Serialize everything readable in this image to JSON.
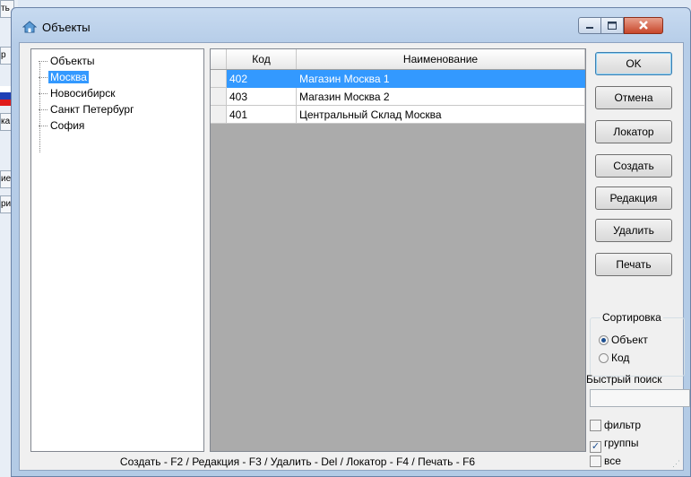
{
  "background": {
    "fragments": [
      "ть",
      "р",
      "ка",
      "ие",
      "ри"
    ]
  },
  "window": {
    "title": "Объекты",
    "icon": "home-icon"
  },
  "tree": {
    "root": "Объекты",
    "items": [
      "Москва",
      "Новосибирск",
      "Санкт Петербург",
      "София"
    ],
    "selected": "Москва"
  },
  "grid": {
    "columns": [
      "Код",
      "Наименование"
    ],
    "rows": [
      {
        "code": "402",
        "name": "Магазин Москва 1",
        "selected": true
      },
      {
        "code": "403",
        "name": "Магазин Москва 2",
        "selected": false
      },
      {
        "code": "401",
        "name": "Центральный Склад Москва",
        "selected": false
      }
    ]
  },
  "buttons": {
    "ok": "OK",
    "cancel": "Отмена",
    "locator": "Локатор",
    "create": "Создать",
    "edit": "Редакция",
    "delete": "Удалить",
    "print": "Печать"
  },
  "sorting": {
    "title": "Сортировка",
    "options": [
      "Объект",
      "Код"
    ],
    "selected": "Объект"
  },
  "quick_search": {
    "label": "Быстрый поиск",
    "value": ""
  },
  "checkboxes": [
    {
      "label": "фильтр",
      "checked": false
    },
    {
      "label": "группы",
      "checked": true
    },
    {
      "label": "все",
      "checked": false
    }
  ],
  "status_bar": "Создать - F2 / Редакция - F3 / Удалить - Del / Локатор - F4 / Печать - F6",
  "colors": {
    "selection": "#3399ff",
    "grid_background": "#ababab",
    "close_button": "#c8462a"
  }
}
